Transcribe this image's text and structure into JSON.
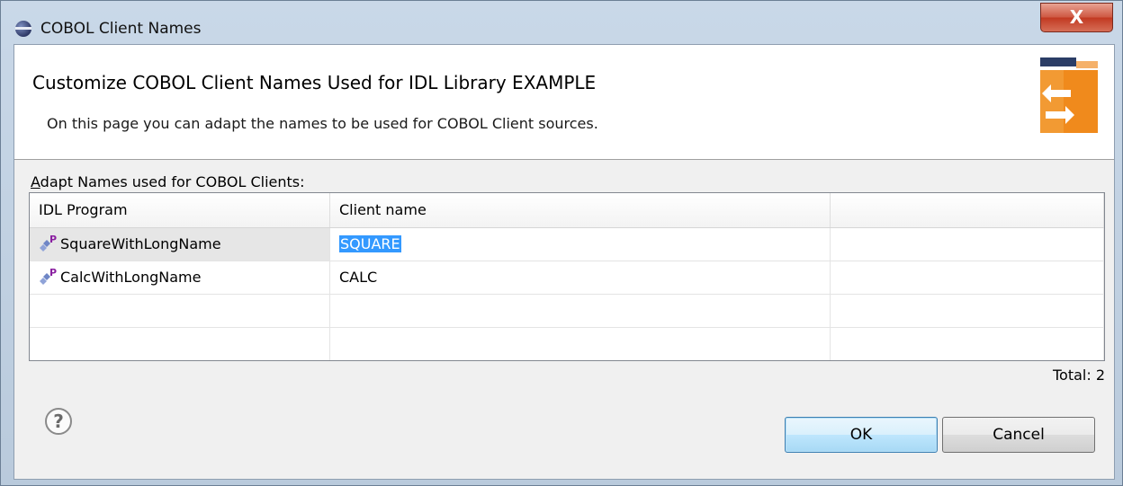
{
  "window": {
    "title": "COBOL Client Names",
    "close_label": "X"
  },
  "banner": {
    "title": "Customize COBOL Client Names Used for IDL Library EXAMPLE",
    "description": "On this page you can adapt the names to be used for COBOL Client sources."
  },
  "section": {
    "label_mnemonic": "A",
    "label_rest": "dapt Names used for COBOL Clients:"
  },
  "table": {
    "columns": [
      "IDL Program",
      "Client name",
      ""
    ],
    "rows": [
      {
        "program": "SquareWithLongName",
        "client_name": "SQUARE",
        "icon": "idl-program-icon",
        "editing": true
      },
      {
        "program": "CalcWithLongName",
        "client_name": "CALC",
        "icon": "idl-program-icon",
        "editing": false
      }
    ],
    "total": "Total: 2"
  },
  "footer": {
    "help_icon": "help-icon",
    "help_glyph": "?",
    "ok_label": "OK",
    "cancel_label": "Cancel"
  },
  "colors": {
    "selection": "#3399ff",
    "accent_orange": "#f08a1c",
    "close_red": "#c23a22"
  }
}
